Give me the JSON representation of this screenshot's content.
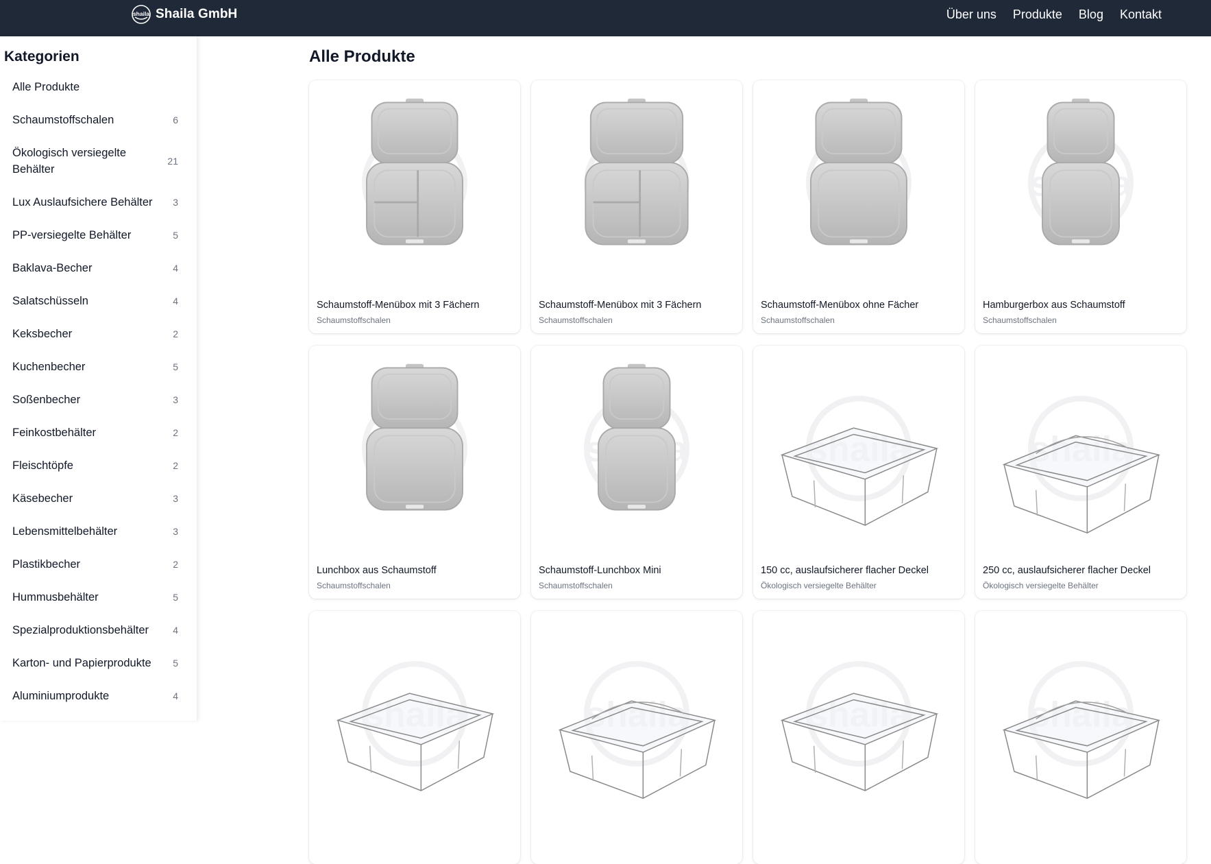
{
  "header": {
    "brand_logo_text": "shaila",
    "brand_name": "Shaila GmbH",
    "nav": [
      {
        "label": "Über uns"
      },
      {
        "label": "Produkte"
      },
      {
        "label": "Blog"
      },
      {
        "label": "Kontakt"
      }
    ]
  },
  "sidebar": {
    "title": "Kategorien",
    "categories": [
      {
        "name": "Alle Produkte",
        "count": ""
      },
      {
        "name": "Schaumstoffschalen",
        "count": "6"
      },
      {
        "name": "Ökologisch versiegelte Behälter",
        "count": "21"
      },
      {
        "name": "Lux Auslaufsichere Behälter",
        "count": "3"
      },
      {
        "name": "PP-versiegelte Behälter",
        "count": "5"
      },
      {
        "name": "Baklava-Becher",
        "count": "4"
      },
      {
        "name": "Salatschüsseln",
        "count": "4"
      },
      {
        "name": "Keksbecher",
        "count": "2"
      },
      {
        "name": "Kuchenbecher",
        "count": "5"
      },
      {
        "name": "Soßenbecher",
        "count": "3"
      },
      {
        "name": "Feinkostbehälter",
        "count": "2"
      },
      {
        "name": "Fleischtöpfe",
        "count": "2"
      },
      {
        "name": "Käsebecher",
        "count": "3"
      },
      {
        "name": "Lebensmittelbehälter",
        "count": "3"
      },
      {
        "name": "Plastikbecher",
        "count": "2"
      },
      {
        "name": "Hummusbehälter",
        "count": "5"
      },
      {
        "name": "Spezialproduktionsbehälter",
        "count": "4"
      },
      {
        "name": "Karton- und Papierprodukte",
        "count": "5"
      },
      {
        "name": "Aluminiumprodukte",
        "count": "4"
      }
    ]
  },
  "main": {
    "title": "Alle Produkte",
    "watermark": "shaila",
    "products": [
      {
        "title": "Schaumstoff-Menübox mit 3 Fächern",
        "category": "Schaumstoffschalen",
        "image": "foam-box-3-compartments"
      },
      {
        "title": "Schaumstoff-Menübox mit 3 Fächern",
        "category": "Schaumstoffschalen",
        "image": "foam-box-3-compartments-wide"
      },
      {
        "title": "Schaumstoff-Menübox ohne Fächer",
        "category": "Schaumstoffschalen",
        "image": "foam-box-no-compartments"
      },
      {
        "title": "Hamburgerbox aus Schaumstoff",
        "category": "Schaumstoffschalen",
        "image": "foam-burger-box"
      },
      {
        "title": "Lunchbox aus Schaumstoff",
        "category": "Schaumstoffschalen",
        "image": "foam-lunch-box"
      },
      {
        "title": "Schaumstoff-Lunchbox Mini",
        "category": "Schaumstoffschalen",
        "image": "foam-lunch-box-mini"
      },
      {
        "title": "150 cc, auslaufsicherer flacher Deckel",
        "category": "Ökologisch versiegelte Behälter",
        "image": "clear-container-flat-lid"
      },
      {
        "title": "250 cc, auslaufsicherer flacher Deckel",
        "category": "Ökologisch versiegelte Behälter",
        "image": "clear-container-flat-lid-deep"
      },
      {
        "title": "",
        "category": "",
        "image": "clear-container"
      },
      {
        "title": "",
        "category": "",
        "image": "clear-container-dome"
      },
      {
        "title": "",
        "category": "",
        "image": "clear-container"
      },
      {
        "title": "",
        "category": "",
        "image": "clear-container-dome"
      }
    ]
  }
}
